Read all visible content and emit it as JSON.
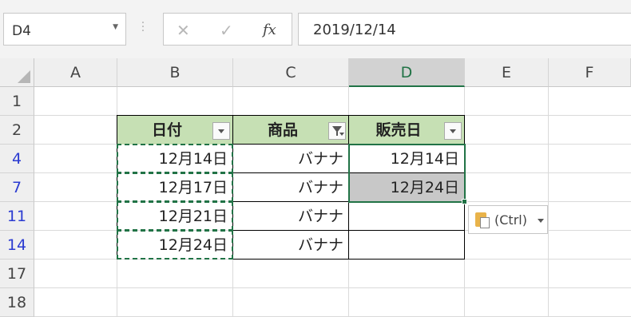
{
  "name_box": {
    "value": "D4"
  },
  "formula_bar": {
    "cancel_icon": "✕",
    "enter_icon": "✓",
    "function_icon": "fx",
    "value": "2019/12/14"
  },
  "columns": [
    "A",
    "B",
    "C",
    "D",
    "E",
    "F"
  ],
  "selected_column": "D",
  "rows": [
    "1",
    "2",
    "4",
    "7",
    "11",
    "14",
    "17",
    "18"
  ],
  "filtered_rows": [
    "4",
    "7",
    "11",
    "14"
  ],
  "table": {
    "headers": [
      "日付",
      "商品",
      "販売日"
    ],
    "data": [
      [
        "12月14日",
        "バナナ",
        "12月14日"
      ],
      [
        "12月17日",
        "バナナ",
        "12月24日"
      ],
      [
        "12月21日",
        "バナナ",
        ""
      ],
      [
        "12月24日",
        "バナナ",
        ""
      ]
    ]
  },
  "paste_options": {
    "label": "(Ctrl)"
  },
  "colors": {
    "header_fill": "#c6e0b4",
    "selection": "#217346",
    "filtered_row_number": "#2b3bd1"
  }
}
